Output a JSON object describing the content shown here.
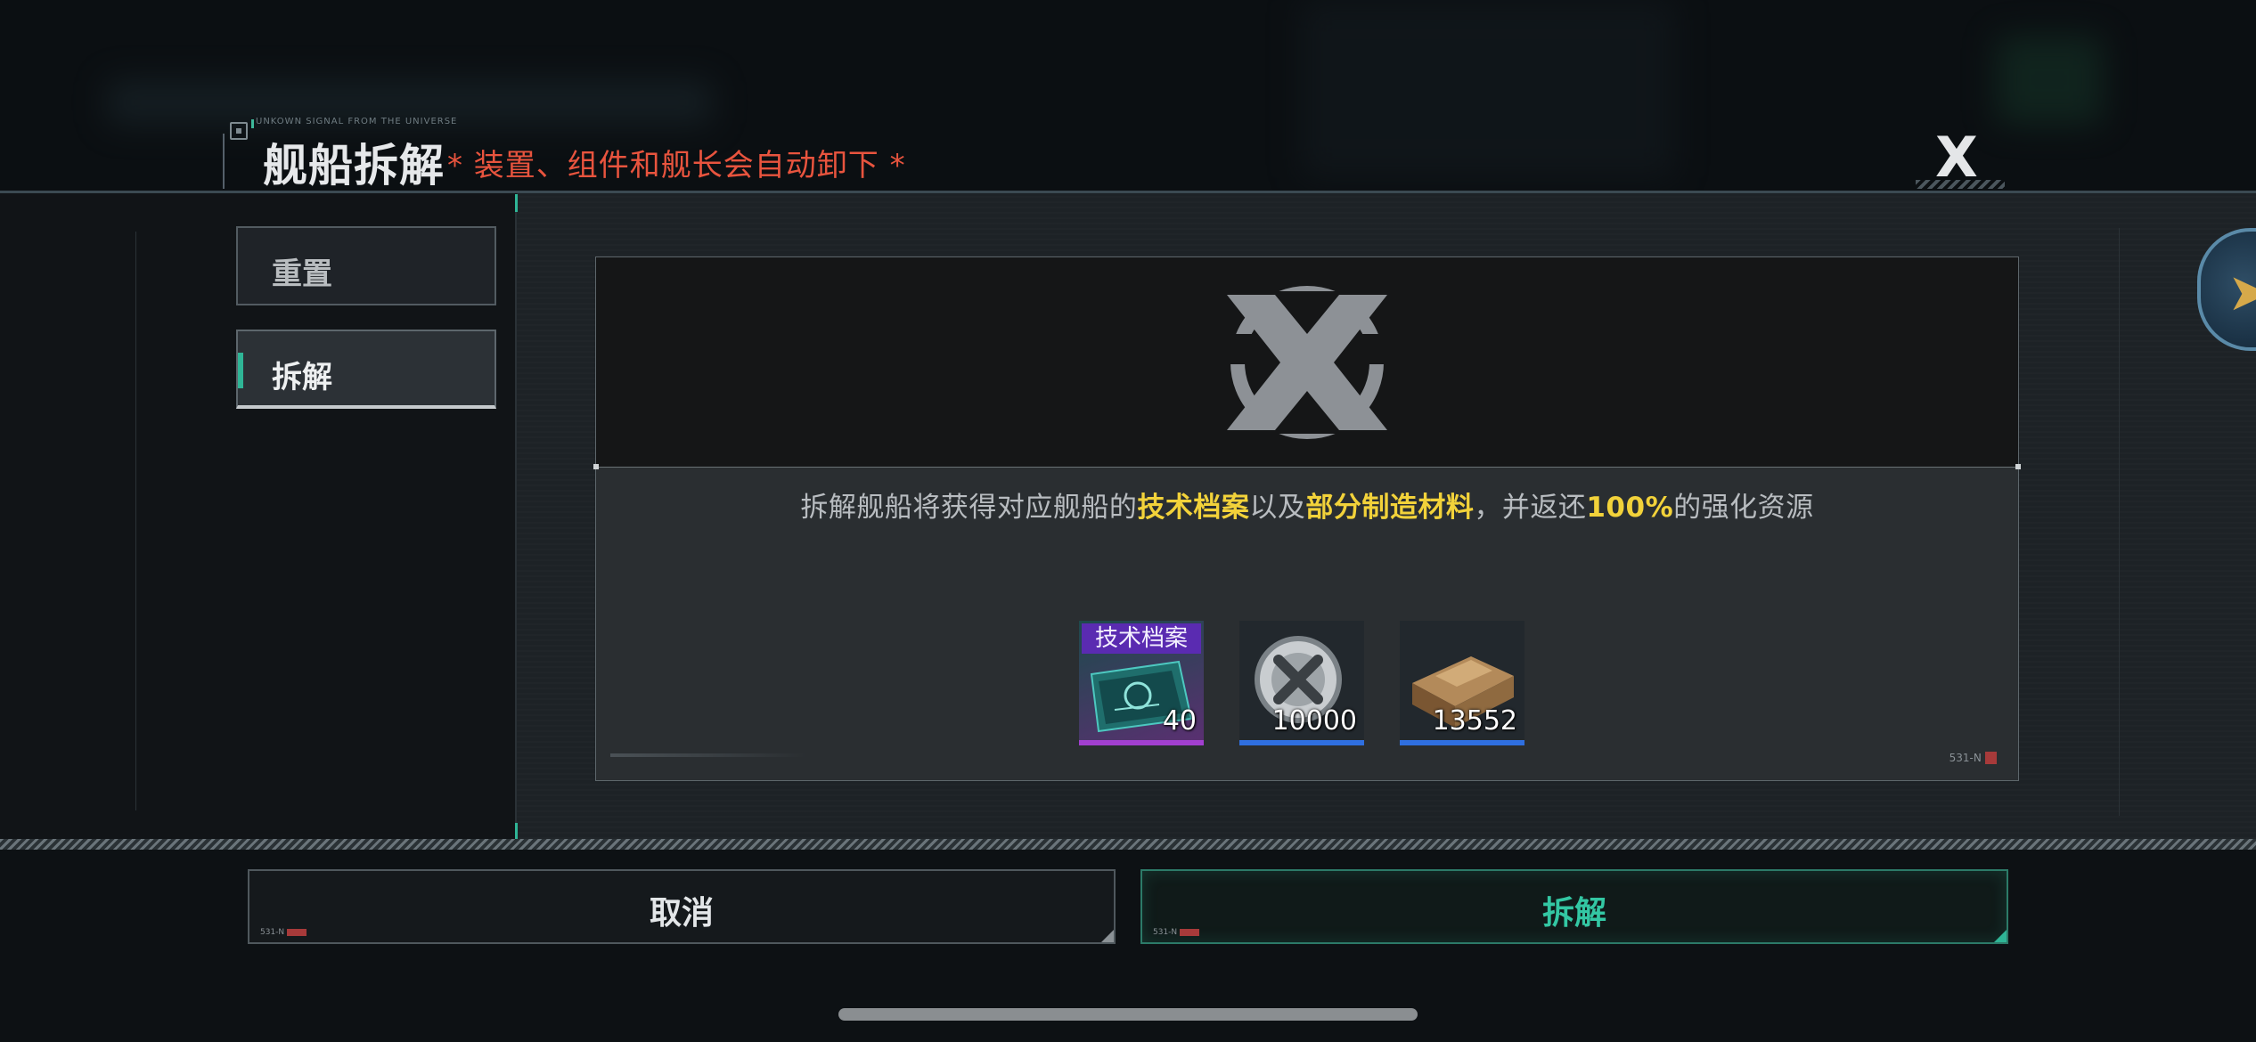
{
  "header": {
    "signal_text": "UNKOWN SIGNAL FROM THE UNIVERSE",
    "title": "舰船拆解",
    "warning": "* 装置、组件和舰长会自动卸下 *",
    "close_label": "X"
  },
  "tabs": [
    {
      "label": "重置",
      "active": false
    },
    {
      "label": "拆解",
      "active": true
    }
  ],
  "card": {
    "description": {
      "p1": "拆解舰船将获得对应舰船的",
      "h1": "技术档案",
      "p2": "以及",
      "h2": "部分制造材料",
      "p3": "，并返还",
      "h3": "100%",
      "p4": "的强化资源"
    },
    "rewards": [
      {
        "icon": "tech-archive-card-icon",
        "tag": "技术档案",
        "quantity": "40",
        "rarity_color": "#a23fd0"
      },
      {
        "icon": "credit-coin-icon",
        "quantity": "10000",
        "rarity_color": "#2f6fe0"
      },
      {
        "icon": "metal-ingot-icon",
        "quantity": "13552",
        "rarity_color": "#2f6fe0"
      }
    ],
    "footer_code": "531-N"
  },
  "buttons": {
    "cancel": {
      "label": "取消",
      "code": "531-N"
    },
    "confirm": {
      "label": "拆解",
      "code": "531-N"
    }
  },
  "colors": {
    "accent": "#2fb596",
    "warning": "#e8543e",
    "highlight": "#f2d23a"
  }
}
